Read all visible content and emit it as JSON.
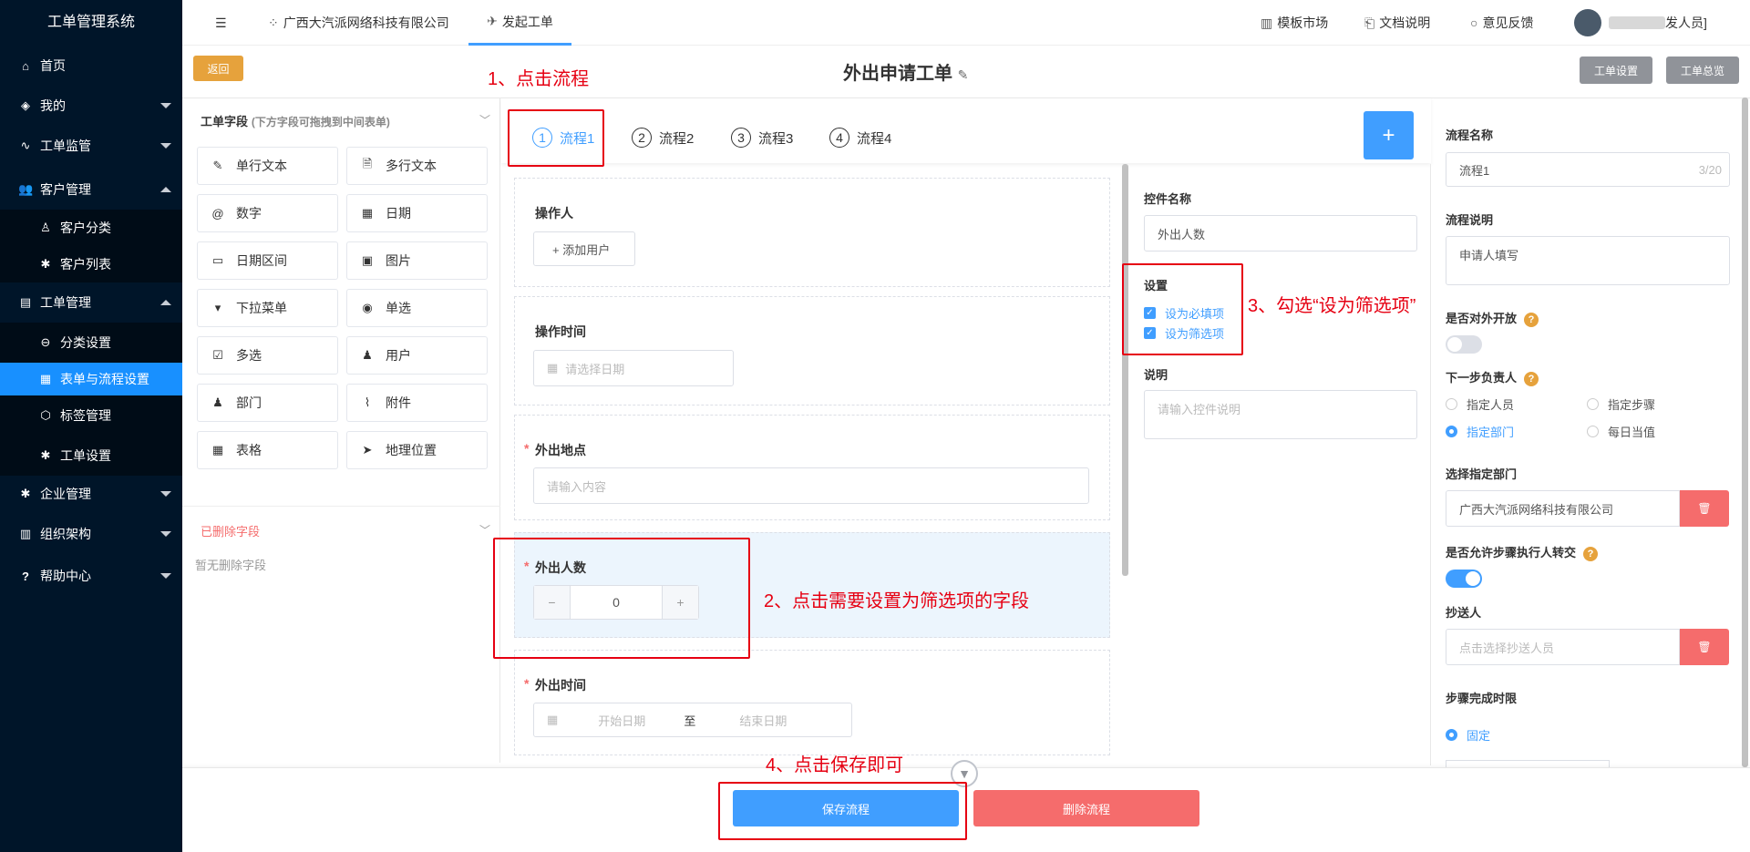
{
  "app_title": "工单管理系统",
  "sidebar": {
    "home": "首页",
    "mine": "我的",
    "monitor": "工单监管",
    "customer": "客户管理",
    "customer_category": "客户分类",
    "customer_list": "客户列表",
    "workorder": "工单管理",
    "category_settings": "分类设置",
    "form_flow_settings": "表单与流程设置",
    "tag_management": "标签管理",
    "workorder_settings": "工单设置",
    "enterprise": "企业管理",
    "org": "组织架构",
    "help": "帮助中心"
  },
  "topbar": {
    "company": "广西大汽派网络科技有限公司",
    "tab": "发起工单",
    "template_market": "模板市场",
    "docs": "文档说明",
    "feedback": "意见反馈",
    "user_suffix": "发人员]"
  },
  "header": {
    "back": "返回",
    "title": "外出申请工单",
    "settings": "工单设置",
    "overview": "工单总览"
  },
  "fields_panel": {
    "title": "工单字段",
    "hint": "(下方字段可拖拽到中间表单)",
    "items": [
      "单行文本",
      "多行文本",
      "数字",
      "日期",
      "日期区间",
      "图片",
      "下拉菜单",
      "单选",
      "多选",
      "用户",
      "部门",
      "附件",
      "表格",
      "地理位置"
    ],
    "deleted_title": "已删除字段",
    "deleted_empty": "暂无删除字段"
  },
  "steps": [
    "流程1",
    "流程2",
    "流程3",
    "流程4"
  ],
  "step_numbers": [
    "1",
    "2",
    "3",
    "4"
  ],
  "form": {
    "operator_label": "操作人",
    "add_user": "+ 添加用户",
    "op_time_label": "操作时间",
    "date_placeholder": "请选择日期",
    "location_label": "外出地点",
    "location_placeholder": "请输入内容",
    "count_label": "外出人数",
    "count_value": "0",
    "time_label": "外出时间",
    "start_placeholder": "开始日期",
    "range_sep": "至",
    "end_placeholder": "结束日期",
    "required_mark": "*"
  },
  "control": {
    "name_label": "控件名称",
    "name_value": "外出人数",
    "settings_label": "设置",
    "required": "设为必填项",
    "filter": "设为筛选项",
    "desc_label": "说明",
    "desc_placeholder": "请输入控件说明"
  },
  "flow": {
    "name_label": "流程名称",
    "name_value": "流程1",
    "name_count": "3/20",
    "desc_label": "流程说明",
    "desc_value": "申请人填写",
    "open_label": "是否对外开放",
    "open_on": false,
    "next_label": "下一步负责人",
    "opt_person": "指定人员",
    "opt_step": "指定步骤",
    "opt_dept": "指定部门",
    "opt_duty": "每日当值",
    "dept_label": "选择指定部门",
    "dept_value": "广西大汽派网络科技有限公司",
    "transfer_label": "是否允许步骤执行人转交",
    "transfer_on": true,
    "cc_label": "抄送人",
    "cc_placeholder": "点击选择抄送人员",
    "limit_label": "步骤完成时限",
    "limit_fixed": "固定"
  },
  "footer": {
    "save": "保存流程",
    "delete": "删除流程"
  },
  "annotations": {
    "a1": "1、点击流程",
    "a2": "2、点击需要设置为筛选项的字段",
    "a3": "3、勾选“设为筛选项”",
    "a4": "4、点击保存即可"
  },
  "colors": {
    "sidebar_bg": "#001529",
    "active": "#1890ff",
    "primary": "#409eff",
    "danger": "#f56c6c",
    "back_btn": "#e6a23c",
    "annotation": "#e60012"
  }
}
